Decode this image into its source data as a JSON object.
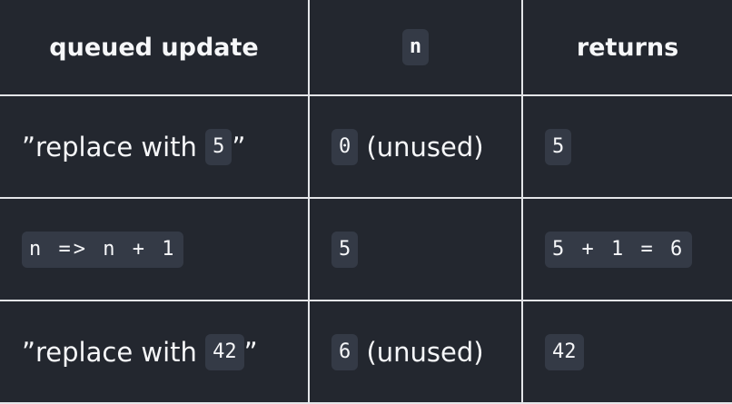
{
  "table": {
    "headers": {
      "queued_update": "queued update",
      "n": "n",
      "returns": "returns"
    },
    "rows": [
      {
        "update_prefix": "”replace with",
        "update_code": "5",
        "update_suffix": "”",
        "n_code": "0",
        "n_note": "(unused)",
        "returns_code": "5"
      },
      {
        "update_code": "n => n + 1",
        "n_code": "5",
        "returns_code": "5 + 1 = 6"
      },
      {
        "update_prefix": "”replace with",
        "update_code": "42",
        "update_suffix": "”",
        "n_code": "6",
        "n_note": "(unused)",
        "returns_code": "42"
      }
    ]
  }
}
